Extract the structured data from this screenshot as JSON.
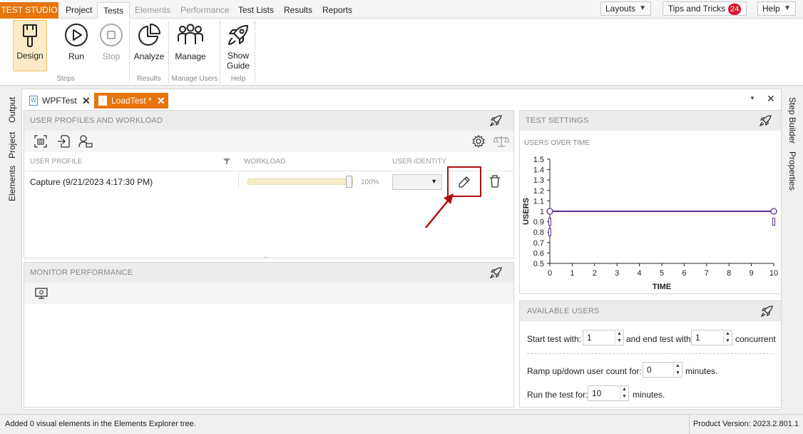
{
  "menubar": {
    "brand": "TEST STUDIO",
    "items": [
      "Project",
      "Tests",
      "Elements",
      "Performance",
      "Test Lists",
      "Results",
      "Reports"
    ],
    "layouts_label": "Layouts",
    "tips_label": "Tips and Tricks",
    "tips_count": "24",
    "help_label": "Help"
  },
  "ribbon": {
    "design_label": "Design",
    "run_label": "Run",
    "stop_label": "Stop",
    "steps_group": "Steps",
    "analyze_label": "Analyze",
    "results_group": "Results",
    "manage_label": "Manage",
    "manage_users_group": "Manage Users",
    "show_label": "Show",
    "guide_label": "Guide",
    "help_group": "Help"
  },
  "left_rail": [
    "Output",
    "Project",
    "Elements"
  ],
  "right_rail": [
    "Step Builder",
    "Properties"
  ],
  "doc_tabs": [
    {
      "label": "WPFTest"
    },
    {
      "label": "LoadTest *"
    }
  ],
  "user_profiles": {
    "header": "USER PROFILES AND WORKLOAD",
    "col_profile": "USER PROFILE",
    "col_workload": "WORKLOAD",
    "col_identity": "USER IDENTITY",
    "row_profile": "Capture (9/21/2023 4:17:30 PM)",
    "row_workload_pct": "100%",
    "row_workload_value": 1.0
  },
  "monitor": {
    "header": "MONITOR PERFORMANCE"
  },
  "test_settings": {
    "header": "TEST SETTINGS",
    "chart_title": "USERS OVER TIME"
  },
  "chart_data": {
    "type": "line",
    "title": "USERS OVER TIME",
    "xlabel": "TIME",
    "ylabel": "USERS",
    "x": [
      0,
      10
    ],
    "series": [
      {
        "values": [
          1,
          1
        ],
        "color": "#5b2d8c"
      }
    ],
    "xlim": [
      0,
      10
    ],
    "ylim": [
      0.5,
      1.5
    ],
    "xticks": [
      "0",
      "1",
      "2",
      "3",
      "4",
      "5",
      "6",
      "7",
      "8",
      "9",
      "10"
    ],
    "yticks": [
      "0.5",
      "0.6",
      "0.7",
      "0.8",
      "0.9",
      "1",
      "1.1",
      "1.2",
      "1.3",
      "1.4",
      "1.5"
    ]
  },
  "available_users": {
    "header": "AVAILABLE USERS",
    "start_label": "Start test with:",
    "start_value": "1",
    "end_label": "and end test with",
    "end_value": "1",
    "concurrent_label": "concurrent",
    "ramp_label": "Ramp up/down user count for:",
    "ramp_value": "0",
    "ramp_unit": "minutes.",
    "run_label": "Run the test for:",
    "run_value": "10",
    "run_unit": "minutes."
  },
  "statusbar": {
    "message": "Added 0 visual elements in the Elements Explorer tree.",
    "version": "Product Version: 2023.2.801.1"
  },
  "colors": {
    "accent": "#e8740c",
    "highlight_box": "#b30d0d",
    "chart_line": "#5b2d8c"
  }
}
